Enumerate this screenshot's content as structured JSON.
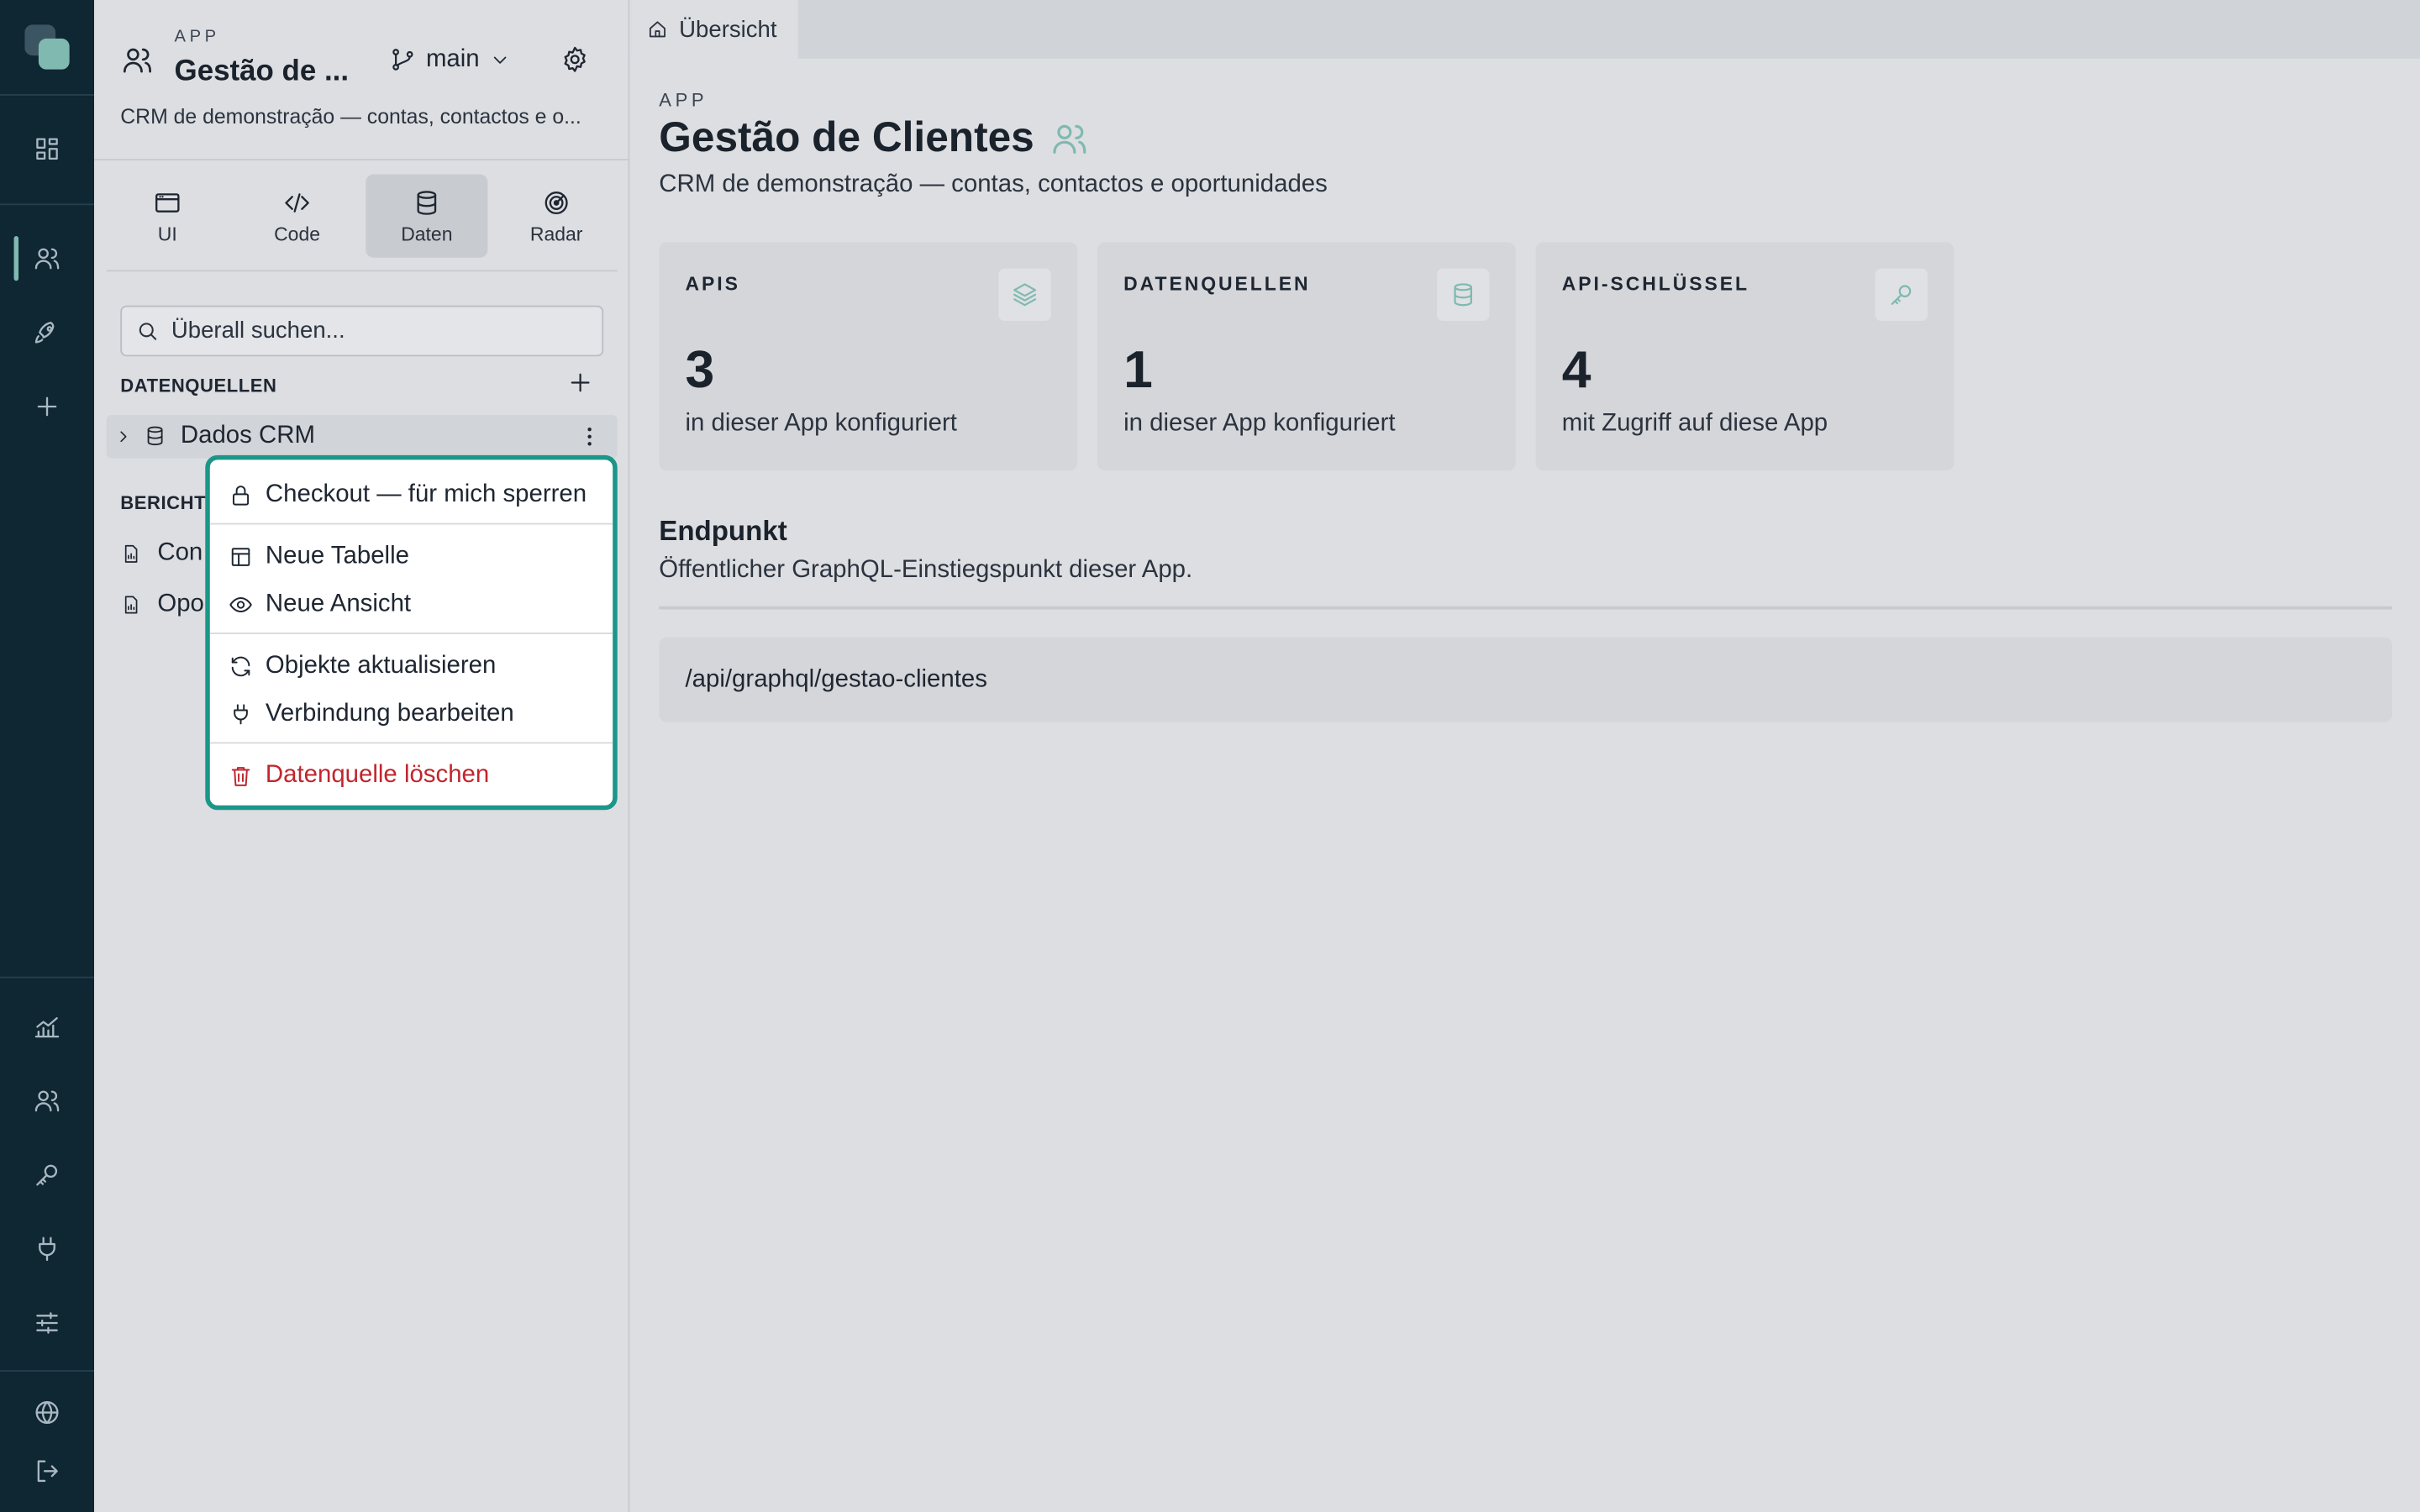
{
  "rail": {
    "icons": [
      "dashboard-icon",
      "users-icon",
      "rocket-icon",
      "plus-icon",
      "analytics-icon",
      "team-icon",
      "key-icon",
      "plug-icon",
      "sliders-icon",
      "globe-icon",
      "logout-icon"
    ],
    "accent": "#7fb9b0",
    "background": "#0f2633"
  },
  "sidebar": {
    "app_kicker": "APP",
    "app_name": "Gestão de ...",
    "branch": "main",
    "description": "CRM de demonstração — contas, contactos e o...",
    "tabs": [
      {
        "label": "UI",
        "icon": "browser-window-icon"
      },
      {
        "label": "Code",
        "icon": "code-icon"
      },
      {
        "label": "Daten",
        "icon": "database-icon",
        "selected": true
      },
      {
        "label": "Radar",
        "icon": "radar-icon"
      }
    ],
    "search": {
      "placeholder": "Überall suchen..."
    },
    "datasources_title": "DATENQUELLEN",
    "datasource": {
      "label": "Dados CRM"
    },
    "reports_title": "BERICHTE",
    "reports": [
      {
        "label": "Con"
      },
      {
        "label": "Opor"
      }
    ]
  },
  "context_menu": {
    "items": [
      {
        "label": "Checkout — für mich sperren",
        "icon": "lock-icon"
      },
      {
        "label": "Neue Tabelle",
        "icon": "table-icon"
      },
      {
        "label": "Neue Ansicht",
        "icon": "eye-icon"
      },
      {
        "label": "Objekte aktualisieren",
        "icon": "refresh-icon"
      },
      {
        "label": "Verbindung bearbeiten",
        "icon": "plug-icon"
      },
      {
        "label": "Datenquelle löschen",
        "icon": "trash-icon",
        "danger": true
      }
    ],
    "border_color": "#1b9689",
    "danger_color": "#c0262d"
  },
  "main": {
    "tab": "Übersicht",
    "kicker": "APP",
    "title": "Gestão de Clientes",
    "subtitle": "CRM de demonstração — contas, contactos e oportunidades",
    "cards": [
      {
        "kicker": "APIS",
        "value": "3",
        "caption": "in dieser App konfiguriert",
        "icon": "layers-icon"
      },
      {
        "kicker": "DATENQUELLEN",
        "value": "1",
        "caption": "in dieser App konfiguriert",
        "icon": "database-icon"
      },
      {
        "kicker": "API-SCHLÜSSEL",
        "value": "4",
        "caption": "mit Zugriff auf diese App",
        "icon": "key-icon"
      }
    ],
    "endpoint": {
      "title": "Endpunkt",
      "description": "Öffentlicher GraphQL-Einstiegspunkt dieser App.",
      "path": "/api/graphql/gestao-clientes"
    }
  }
}
